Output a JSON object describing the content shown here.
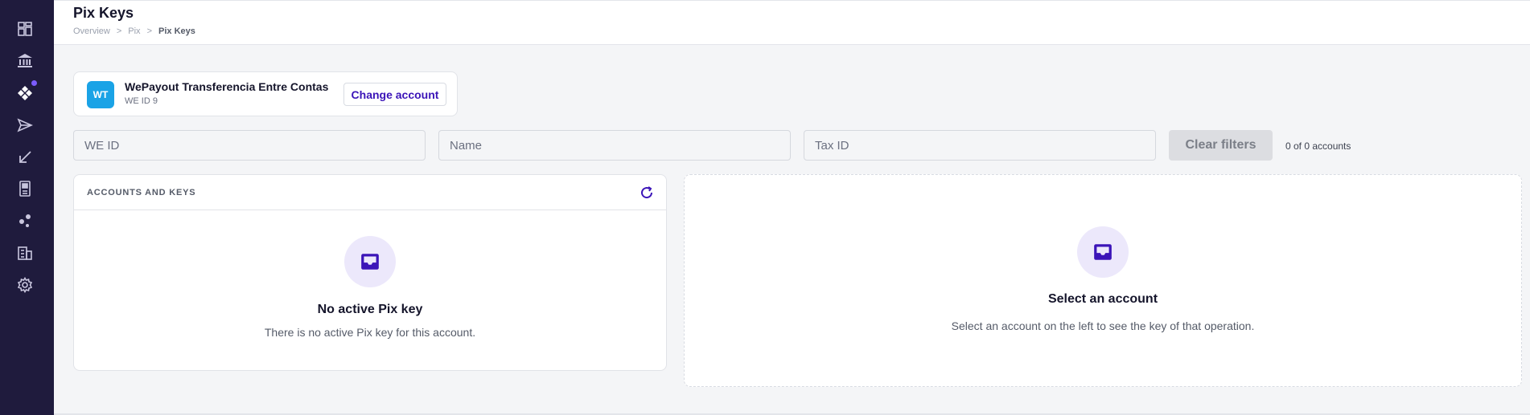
{
  "header": {
    "title": "Pix Keys",
    "breadcrumb": [
      "Overview",
      "Pix",
      "Pix Keys"
    ],
    "breadcrumb_separator": ">"
  },
  "sidebar": {
    "items": [
      {
        "icon": "dashboard-icon"
      },
      {
        "icon": "bank-icon"
      },
      {
        "icon": "pix-icon",
        "badge": true
      },
      {
        "icon": "send-icon"
      },
      {
        "icon": "receive-arrow-icon"
      },
      {
        "icon": "pos-terminal-icon"
      },
      {
        "icon": "share-nodes-icon"
      },
      {
        "icon": "building-icon"
      },
      {
        "icon": "gear-icon"
      }
    ]
  },
  "account": {
    "initials": "WT",
    "name": "WePayout Transferencia Entre Contas",
    "id_label": "WE ID 9",
    "change_label": "Change account",
    "avatar_color": "#1aa3e6"
  },
  "filters": {
    "we_id_placeholder": "WE ID",
    "name_placeholder": "Name",
    "tax_id_placeholder": "Tax ID",
    "clear_label": "Clear filters",
    "count_text": "0 of 0 accounts"
  },
  "accounts_panel": {
    "title": "ACCOUNTS AND KEYS",
    "empty_title": "No active Pix key",
    "empty_desc": "There is no active Pix key for this account."
  },
  "detail_panel": {
    "empty_title": "Select an account",
    "empty_desc": "Select an account on the left to see the key of that operation."
  },
  "colors": {
    "sidebar_bg": "#1f1b3d",
    "accent": "#3b14b8",
    "accent_light": "#ece8fb"
  }
}
